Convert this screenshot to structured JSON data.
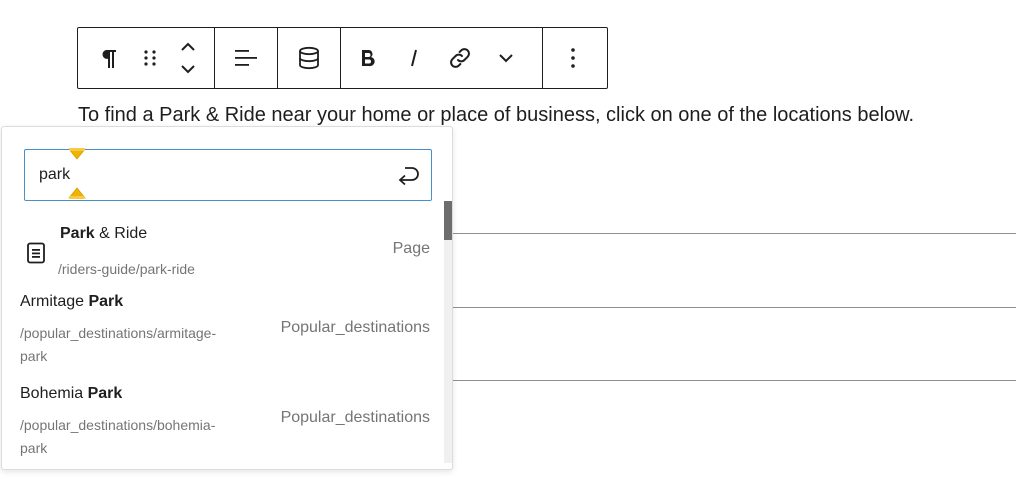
{
  "toolbar": {
    "groups": [
      {
        "buttons": [
          {
            "icon": "paragraph-icon"
          },
          {
            "icon": "drag-handle-icon"
          },
          {
            "icon": "move-up-icon"
          },
          {
            "icon": "move-down-icon"
          }
        ]
      },
      {
        "buttons": [
          {
            "icon": "align-left-icon"
          }
        ]
      },
      {
        "buttons": [
          {
            "icon": "database-icon"
          }
        ]
      },
      {
        "buttons": [
          {
            "icon": "bold-icon"
          },
          {
            "icon": "italic-icon"
          },
          {
            "icon": "link-icon"
          },
          {
            "icon": "chevron-down-icon"
          }
        ]
      },
      {
        "buttons": [
          {
            "icon": "more-options-icon"
          }
        ]
      }
    ]
  },
  "paragraph": {
    "text": "To find a Park & Ride near your home or place of business, click on one of the locations below."
  },
  "link_popover": {
    "search": {
      "value": "park"
    },
    "results": [
      {
        "title_match": "Park",
        "title_rest": "& Ride",
        "url": "/riders-guide/park-ride",
        "type": "Page",
        "icon": "page-icon"
      },
      {
        "title_prefix": "Armitage",
        "title_match": "Park",
        "url_line1": "/popular_destinations/armitage-",
        "url_line2": "park",
        "type": "Popular_destinations"
      },
      {
        "title_prefix": "Bohemia",
        "title_match": "Park",
        "url_line1": "/popular_destinations/bohemia-",
        "url_line2": "park",
        "type": "Popular_destinations"
      }
    ]
  },
  "colors": {
    "focus": "#4a90c8",
    "selection_handle": "#f0b400",
    "muted": "#757575"
  }
}
